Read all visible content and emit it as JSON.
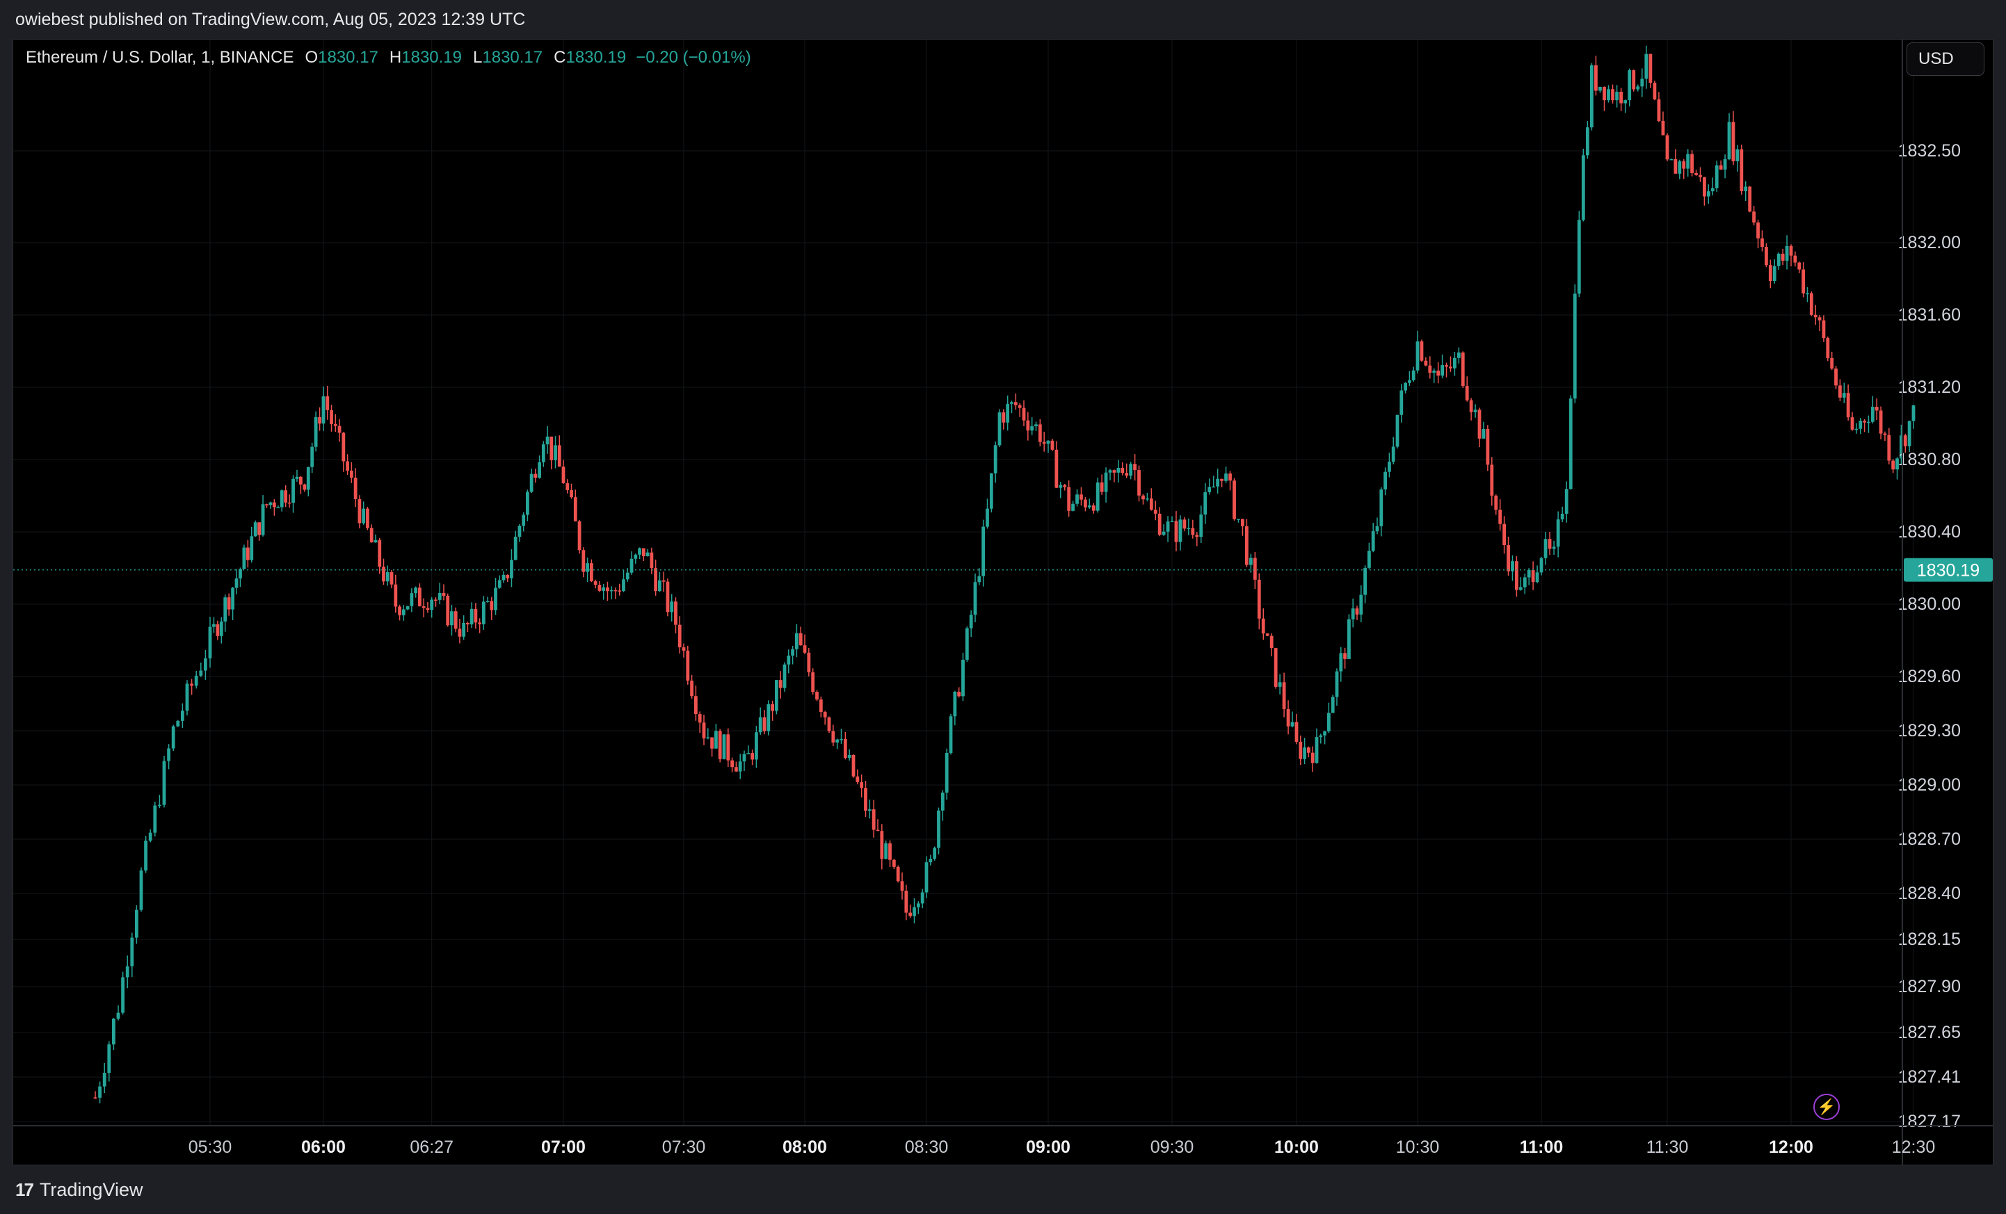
{
  "publish_note": "owiebest published on TradingView.com, Aug 05, 2023 12:39 UTC",
  "legend": {
    "symbol": "Ethereum / U.S. Dollar, 1, BINANCE",
    "o_label": "O",
    "o_value": "1830.17",
    "h_label": "H",
    "h_value": "1830.19",
    "l_label": "L",
    "l_value": "1830.17",
    "c_label": "C",
    "c_value": "1830.19",
    "change": "−0.20 (−0.01%)"
  },
  "currency_button": "USD",
  "footer": {
    "brand": "TradingView",
    "logo_icon": "tradingview-logo-icon"
  },
  "colors": {
    "up": "#26a69a",
    "down": "#ef5350",
    "background": "#000000",
    "price_tag": "#26a69a"
  },
  "chart_data": {
    "type": "candlestick",
    "symbol": "Ethereum / U.S. Dollar, 1, BINANCE",
    "interval": "1",
    "last_price": "1830.19",
    "x_tick_labels": [
      {
        "label": "05:30",
        "bold": false
      },
      {
        "label": "06:00",
        "bold": true
      },
      {
        "label": "06:27",
        "bold": false
      },
      {
        "label": "07:00",
        "bold": true
      },
      {
        "label": "07:30",
        "bold": false
      },
      {
        "label": "08:00",
        "bold": true
      },
      {
        "label": "08:30",
        "bold": false
      },
      {
        "label": "09:00",
        "bold": true
      },
      {
        "label": "09:30",
        "bold": false
      },
      {
        "label": "10:00",
        "bold": true
      },
      {
        "label": "10:30",
        "bold": false
      },
      {
        "label": "11:00",
        "bold": true
      },
      {
        "label": "11:30",
        "bold": false
      },
      {
        "label": "12:00",
        "bold": true
      },
      {
        "label": "12:30",
        "bold": false
      }
    ],
    "y_tick_labels": [
      "1832.50",
      "1832.00",
      "1831.60",
      "1831.20",
      "1830.80",
      "1830.40",
      "1830.00",
      "1829.60",
      "1829.30",
      "1829.00",
      "1828.70",
      "1828.40",
      "1828.15",
      "1827.90",
      "1827.65",
      "1827.41",
      "1827.17"
    ],
    "price_path": [
      {
        "t": "05:05",
        "p": 1827.3
      },
      {
        "t": "05:10",
        "p": 1827.8
      },
      {
        "t": "05:15",
        "p": 1828.5
      },
      {
        "t": "05:22",
        "p": 1829.3
      },
      {
        "t": "05:30",
        "p": 1829.8
      },
      {
        "t": "05:38",
        "p": 1830.2
      },
      {
        "t": "05:45",
        "p": 1830.55
      },
      {
        "t": "05:55",
        "p": 1830.7
      },
      {
        "t": "06:00",
        "p": 1831.15
      },
      {
        "t": "06:05",
        "p": 1830.8
      },
      {
        "t": "06:10",
        "p": 1830.45
      },
      {
        "t": "06:18",
        "p": 1830.0
      },
      {
        "t": "06:27",
        "p": 1830.05
      },
      {
        "t": "06:35",
        "p": 1829.85
      },
      {
        "t": "06:45",
        "p": 1830.1
      },
      {
        "t": "06:55",
        "p": 1830.95
      },
      {
        "t": "07:00",
        "p": 1830.7
      },
      {
        "t": "07:05",
        "p": 1830.25
      },
      {
        "t": "07:12",
        "p": 1830.05
      },
      {
        "t": "07:20",
        "p": 1830.3
      },
      {
        "t": "07:28",
        "p": 1829.9
      },
      {
        "t": "07:35",
        "p": 1829.3
      },
      {
        "t": "07:45",
        "p": 1829.1
      },
      {
        "t": "07:52",
        "p": 1829.45
      },
      {
        "t": "07:58",
        "p": 1829.8
      },
      {
        "t": "08:05",
        "p": 1829.4
      },
      {
        "t": "08:12",
        "p": 1829.05
      },
      {
        "t": "08:20",
        "p": 1828.6
      },
      {
        "t": "08:25",
        "p": 1828.3
      },
      {
        "t": "08:31",
        "p": 1828.55
      },
      {
        "t": "08:35",
        "p": 1829.2
      },
      {
        "t": "08:40",
        "p": 1829.8
      },
      {
        "t": "08:45",
        "p": 1830.5
      },
      {
        "t": "08:48",
        "p": 1831.05
      },
      {
        "t": "08:52",
        "p": 1831.1
      },
      {
        "t": "08:58",
        "p": 1830.95
      },
      {
        "t": "09:05",
        "p": 1830.55
      },
      {
        "t": "09:12",
        "p": 1830.6
      },
      {
        "t": "09:20",
        "p": 1830.8
      },
      {
        "t": "09:25",
        "p": 1830.5
      },
      {
        "t": "09:30",
        "p": 1830.4
      },
      {
        "t": "09:36",
        "p": 1830.45
      },
      {
        "t": "09:42",
        "p": 1830.75
      },
      {
        "t": "09:47",
        "p": 1830.4
      },
      {
        "t": "09:52",
        "p": 1829.85
      },
      {
        "t": "10:00",
        "p": 1829.2
      },
      {
        "t": "10:05",
        "p": 1829.2
      },
      {
        "t": "10:10",
        "p": 1829.6
      },
      {
        "t": "10:15",
        "p": 1830.0
      },
      {
        "t": "10:20",
        "p": 1830.45
      },
      {
        "t": "10:25",
        "p": 1831.05
      },
      {
        "t": "10:30",
        "p": 1831.45
      },
      {
        "t": "10:35",
        "p": 1831.25
      },
      {
        "t": "10:40",
        "p": 1831.35
      },
      {
        "t": "10:46",
        "p": 1830.9
      },
      {
        "t": "10:50",
        "p": 1830.4
      },
      {
        "t": "10:55",
        "p": 1830.05
      },
      {
        "t": "11:00",
        "p": 1830.3
      },
      {
        "t": "11:03",
        "p": 1830.25
      },
      {
        "t": "11:06",
        "p": 1830.7
      },
      {
        "t": "11:09",
        "p": 1832.2
      },
      {
        "t": "11:12",
        "p": 1832.9
      },
      {
        "t": "11:18",
        "p": 1832.8
      },
      {
        "t": "11:25",
        "p": 1832.95
      },
      {
        "t": "11:30",
        "p": 1832.4
      },
      {
        "t": "11:35",
        "p": 1832.45
      },
      {
        "t": "11:40",
        "p": 1832.25
      },
      {
        "t": "11:45",
        "p": 1832.6
      },
      {
        "t": "11:50",
        "p": 1832.2
      },
      {
        "t": "11:55",
        "p": 1831.85
      },
      {
        "t": "12:00",
        "p": 1831.95
      },
      {
        "t": "12:06",
        "p": 1831.6
      },
      {
        "t": "12:10",
        "p": 1831.3
      },
      {
        "t": "12:15",
        "p": 1830.95
      },
      {
        "t": "12:20",
        "p": 1831.1
      },
      {
        "t": "12:25",
        "p": 1830.8
      },
      {
        "t": "12:30",
        "p": 1831.05
      },
      {
        "t": "12:33",
        "p": 1831.15
      },
      {
        "t": "12:35",
        "p": 1830.8
      },
      {
        "t": "12:37",
        "p": 1830.1
      },
      {
        "t": "12:39",
        "p": 1830.19
      }
    ]
  }
}
